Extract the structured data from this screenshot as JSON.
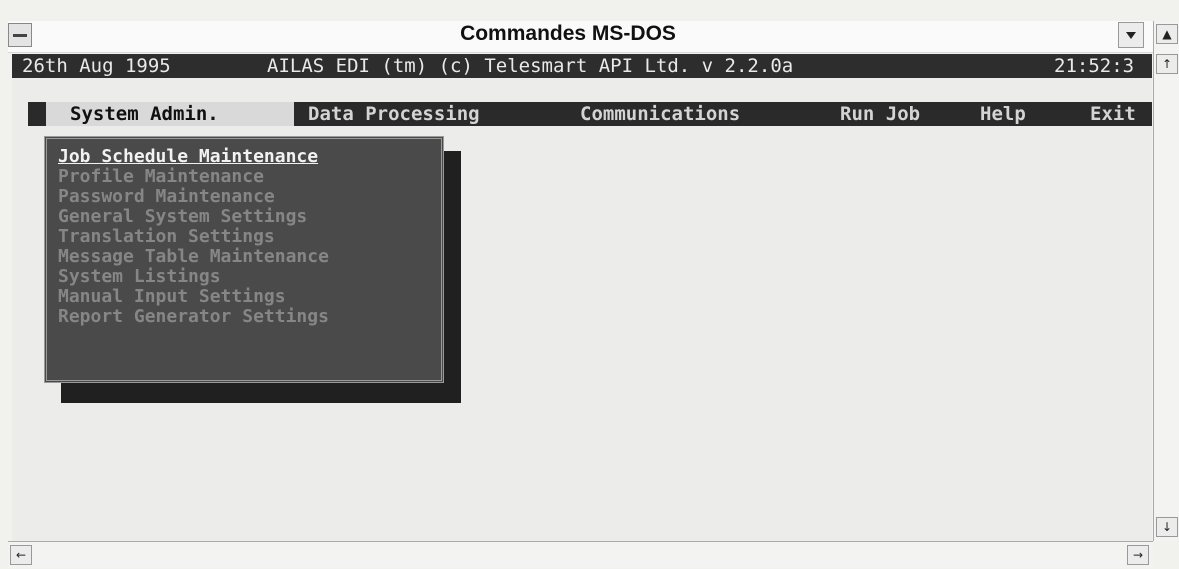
{
  "window": {
    "title": "Commandes MS-DOS"
  },
  "status": {
    "date": "26th Aug 1995",
    "product": "AILAS EDI (tm) (c) Telesmart API Ltd. v 2.2.0a",
    "time": "21:52:3"
  },
  "menu": {
    "items": [
      {
        "label": "System Admin."
      },
      {
        "label": "Data Processing"
      },
      {
        "label": "Communications"
      },
      {
        "label": "Run Job"
      },
      {
        "label": "Help"
      },
      {
        "label": "Exit"
      }
    ]
  },
  "dropdown": {
    "items": [
      {
        "label": "Job Schedule Maintenance"
      },
      {
        "label": "Profile Maintenance"
      },
      {
        "label": "Password Maintenance"
      },
      {
        "label": "General System Settings"
      },
      {
        "label": "Translation Settings"
      },
      {
        "label": "Message Table Maintenance"
      },
      {
        "label": "System Listings"
      },
      {
        "label": "Manual Input Settings"
      },
      {
        "label": "Report Generator Settings"
      }
    ]
  },
  "icons": {
    "system_menu": "system-menu-icon",
    "minimize": "minimize-arrow-icon",
    "scroll_up": "scroll-up-arrow-icon",
    "scroll_down": "scroll-down-arrow-icon",
    "scroll_left": "scroll-left-arrow-icon",
    "scroll_right": "scroll-right-arrow-icon"
  }
}
